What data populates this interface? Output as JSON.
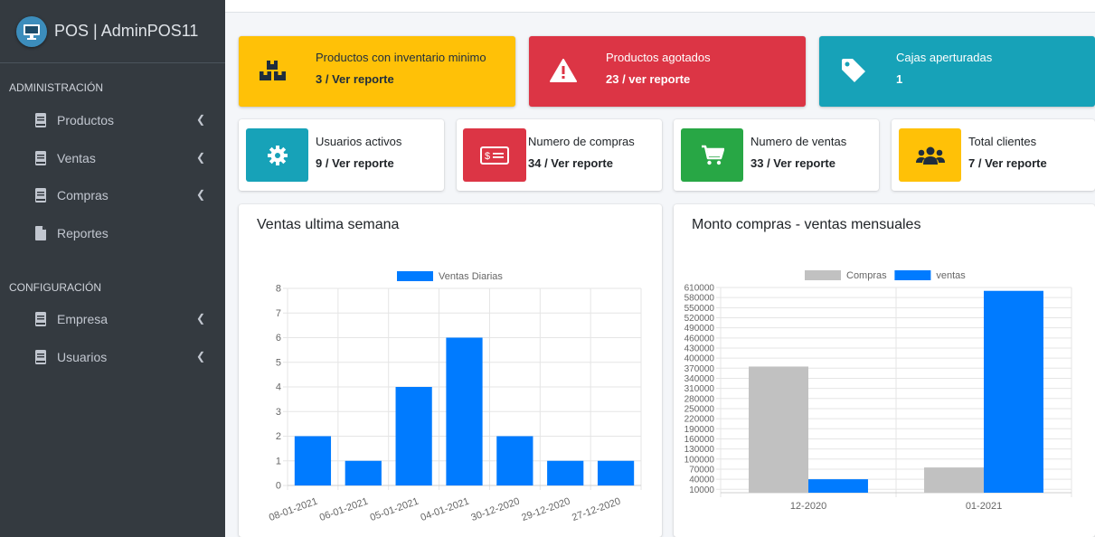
{
  "brand": {
    "title": "POS | AdminPOS11"
  },
  "sidebar": {
    "admin_header": "ADMINISTRACIÓN",
    "config_header": "CONFIGURACIÓN",
    "items": [
      {
        "label": "Productos",
        "icon": "book-icon",
        "has_submenu": true
      },
      {
        "label": "Ventas",
        "icon": "book-icon",
        "has_submenu": true
      },
      {
        "label": "Compras",
        "icon": "book-icon",
        "has_submenu": true
      },
      {
        "label": "Reportes",
        "icon": "file-icon",
        "has_submenu": false
      },
      {
        "label": "Empresa",
        "icon": "book-icon",
        "has_submenu": true
      },
      {
        "label": "Usuarios",
        "icon": "book-icon",
        "has_submenu": true
      }
    ]
  },
  "big_boxes": [
    {
      "title": "Productos con inventario minimo",
      "value": "3 / Ver reporte",
      "color": "#ffc107",
      "text_color": "#1f2d3d",
      "icon": "cubes-icon"
    },
    {
      "title": "Productos agotados",
      "value": "23 / ver reporte",
      "color": "#dc3545",
      "text_color": "#ffffff",
      "icon": "warning-icon"
    },
    {
      "title": "Cajas aperturadas",
      "value": "1",
      "color": "#17a2b8",
      "text_color": "#ffffff",
      "icon": "tag-icon"
    }
  ],
  "small_boxes": [
    {
      "title": "Usuarios activos",
      "value": "9 / Ver reporte",
      "color": "#17a2b8",
      "icon": "gear-icon"
    },
    {
      "title": "Numero de compras",
      "value": "34 / Ver reporte",
      "color": "#dc3545",
      "icon": "money-bill-icon"
    },
    {
      "title": "Numero de ventas",
      "value": "33 / Ver reporte",
      "color": "#28a745",
      "icon": "cart-icon"
    },
    {
      "title": "Total clientes",
      "value": "7 / Ver reporte",
      "color": "#ffc107",
      "icon": "users-icon"
    }
  ],
  "cards": {
    "left_title": "Ventas ultima semana",
    "right_title": "Monto compras - ventas mensuales"
  },
  "chart_data": [
    {
      "type": "bar",
      "title": "",
      "categories": [
        "08-01-2021",
        "06-01-2021",
        "05-01-2021",
        "04-01-2021",
        "30-12-2020",
        "29-12-2020",
        "27-12-2020"
      ],
      "series": [
        {
          "name": "Ventas Diarias",
          "values": [
            2,
            1,
            4,
            6,
            2,
            1,
            1
          ],
          "color": "#007bff"
        }
      ],
      "ylim": [
        0,
        8
      ],
      "yticks": [
        0,
        1,
        2,
        3,
        4,
        5,
        6,
        7,
        8
      ],
      "grid": true,
      "legend": "top"
    },
    {
      "type": "bar",
      "title": "",
      "categories": [
        "12-2020",
        "01-2021"
      ],
      "series": [
        {
          "name": "Compras",
          "values": [
            375000,
            75000
          ],
          "color": "#c1c1c1"
        },
        {
          "name": "ventas",
          "values": [
            40000,
            600000
          ],
          "color": "#007bff"
        }
      ],
      "ylim": [
        0,
        610000
      ],
      "yticks": [
        10000,
        40000,
        70000,
        100000,
        130000,
        160000,
        190000,
        220000,
        250000,
        280000,
        310000,
        340000,
        370000,
        400000,
        430000,
        460000,
        490000,
        520000,
        550000,
        580000,
        610000
      ],
      "grid": true,
      "legend": "top"
    }
  ]
}
